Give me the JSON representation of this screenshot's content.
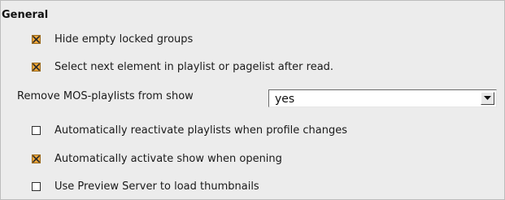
{
  "section": {
    "title": "General"
  },
  "options": [
    {
      "label": "Hide empty locked groups",
      "checked": true
    },
    {
      "label": "Select next element in playlist or pagelist after read.",
      "checked": true
    },
    {
      "label": "Automatically reactivate playlists when profile changes",
      "checked": false
    },
    {
      "label": "Automatically activate show when opening",
      "checked": true
    },
    {
      "label": "Use Preview Server to load thumbnails",
      "checked": false
    }
  ],
  "remove_mos": {
    "label": "Remove MOS-playlists from show",
    "value": "yes"
  },
  "colors": {
    "check_accent": "#f3a93a",
    "panel_bg": "#ececec"
  }
}
